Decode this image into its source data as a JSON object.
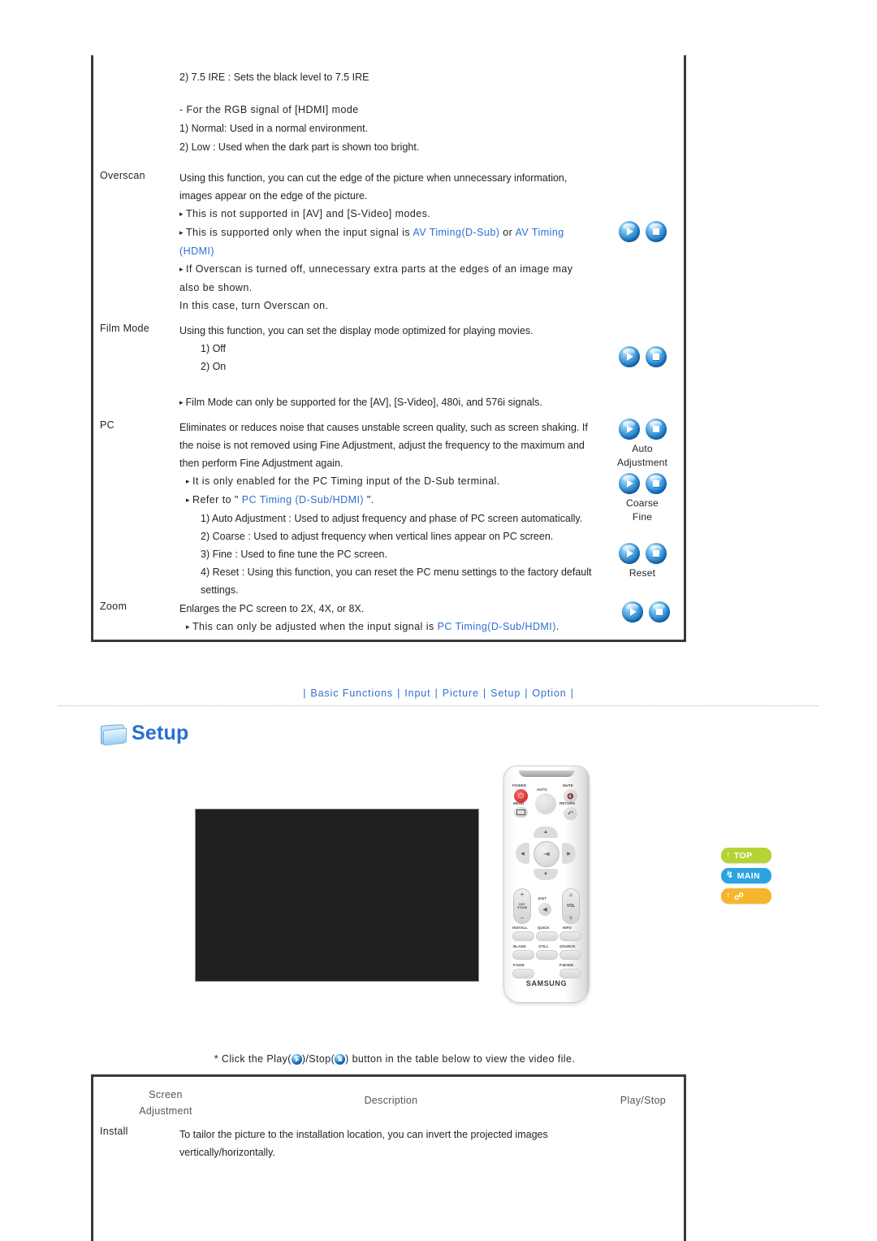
{
  "top_table": {
    "preamble": [
      {
        "text": "2) 7.5 IRE : Sets the black level to 7.5 IRE"
      },
      {
        "text": "- For the RGB signal of [HDMI] mode"
      },
      {
        "text": "1) Normal: Used in a normal environment."
      },
      {
        "text": "2) Low : Used when the dark part is shown too bright."
      }
    ],
    "rows": [
      {
        "label": "Overscan",
        "lines": [
          "Using this function, you can cut the edge of the picture when unnecessary information,",
          "images appear on the edge of the picture."
        ],
        "bullets": [
          "This is not supported in [AV] and [S-Video] modes."
        ],
        "bullet_link_pre": "This is supported only when the input signal is ",
        "link_a": "AV Timing(D-Sub)",
        "link_mid": " or ",
        "link_b": "AV Timing (HDMI)",
        "bullet_link_post": ".",
        "bullets_after": [
          "If Overscan is turned off, unnecessary extra parts at the edges of an image may",
          "also be shown.",
          "In this case, turn Overscan on."
        ]
      },
      {
        "label": "Film Mode",
        "lines": [
          "Using this function, you can set the display mode optimized for playing movies."
        ],
        "options": [
          "1) Off",
          "2) On"
        ],
        "note": "Film Mode can only be supported for the [AV], [S-Video], 480i, and 576i signals."
      },
      {
        "label": "PC",
        "lines": [
          "Eliminates or reduces noise that causes unstable screen quality, such as screen shaking. If",
          "the noise is not removed using Fine Adjustment, adjust the frequency to the maximum and",
          "then perform Fine Adjustment again."
        ],
        "bullets": [
          "It is only enabled for the PC Timing input of the D-Sub terminal."
        ],
        "refer_pre": "Refer to \" ",
        "refer_link": "PC Timing (D-Sub/HDMI)",
        "refer_post": " \".",
        "options": [
          "1) Auto Adjustment : Used to adjust frequency and phase of PC screen automatically.",
          "2) Coarse : Used to adjust frequency when vertical lines appear on PC screen.",
          "3) Fine : Used to fine tune the PC screen.",
          "4) Reset : Using this function, you can reset the PC menu settings to the factory default",
          "settings."
        ]
      },
      {
        "label": "Zoom",
        "lines": [
          "Enlarges the PC screen to 2X, 4X, or 8X."
        ],
        "bullet_link_pre": "This can only be adjusted when the input signal is ",
        "link_a": "PC Timing(D-Sub/HDMI)",
        "bullet_link_post": "."
      }
    ],
    "controls": [
      {
        "caption": "",
        "second": ""
      },
      {
        "caption": "",
        "second": ""
      },
      {
        "caption": "Auto",
        "second": "Adjustment"
      },
      {
        "caption": "Coarse",
        "second": "Fine"
      },
      {
        "caption": "Reset",
        "second": ""
      },
      {
        "caption": "",
        "second": ""
      }
    ],
    "icons": {
      "play": "play-icon",
      "stop": "stop-icon"
    }
  },
  "nav": {
    "items": [
      "Basic Functions",
      "Input",
      "Picture",
      "Setup",
      "Option"
    ],
    "separator": "|"
  },
  "section": {
    "icon": "folder-icon",
    "title": "Setup"
  },
  "side_buttons": [
    {
      "id": "top",
      "label": "TOP",
      "icon": "arrow-up-icon",
      "color": "#b5d334"
    },
    {
      "id": "main",
      "label": "MAIN",
      "icon": "arrow-branch-icon",
      "color": "#2aa4e2"
    },
    {
      "id": "home",
      "label": "",
      "icon": "arrow-up-link-icon",
      "color": "#f6b52a"
    }
  ],
  "note": {
    "prefix": "*  Click the Play(",
    "middle": ")/Stop(",
    "suffix": ") button in the table below to view the video file."
  },
  "bottom_table": {
    "headers": {
      "col1_line1": "Screen",
      "col1_line2": "Adjustment",
      "col2": "Description",
      "col3": "Play/Stop"
    },
    "rows": [
      {
        "label": "Install",
        "lines": [
          "To tailor the picture to the installation location, you can invert the projected images",
          "vertically/horizontally."
        ]
      }
    ]
  }
}
